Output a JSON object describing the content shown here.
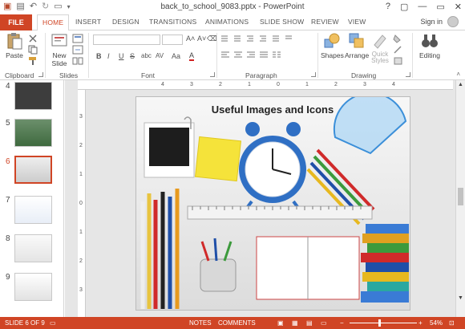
{
  "window": {
    "title": "back_to_school_9083.pptx - PowerPoint",
    "controls": [
      "?",
      "▢",
      "—",
      "▭",
      "✕"
    ]
  },
  "tabs": {
    "file": "FILE",
    "items": [
      "HOME",
      "INSERT",
      "DESIGN",
      "TRANSITIONS",
      "ANIMATIONS",
      "SLIDE SHOW",
      "REVIEW",
      "VIEW"
    ],
    "active": "HOME",
    "signin": "Sign in"
  },
  "ribbon": {
    "clipboard": {
      "label": "Clipboard",
      "paste": "Paste"
    },
    "slides": {
      "label": "Slides",
      "new_slide": "New Slide"
    },
    "font": {
      "label": "Font",
      "buttons": [
        "B",
        "I",
        "U",
        "S",
        "abc",
        "AV",
        "Aa",
        "A"
      ]
    },
    "paragraph": {
      "label": "Paragraph"
    },
    "drawing": {
      "label": "Drawing",
      "shapes": "Shapes",
      "arrange": "Arrange",
      "quick_styles": "Quick Styles"
    },
    "editing": {
      "label": "Editing",
      "editing": "Editing"
    }
  },
  "thumbnails": {
    "numbers": [
      "4",
      "5",
      "6",
      "7",
      "8",
      "9"
    ],
    "selected": "6"
  },
  "ruler": {
    "h_numbers": [
      "4",
      "3",
      "2",
      "1",
      "0",
      "1",
      "2",
      "3",
      "4"
    ],
    "v_numbers": [
      "3",
      "2",
      "1",
      "0",
      "1",
      "2",
      "3"
    ]
  },
  "slide": {
    "title": "Useful Images and Icons"
  },
  "status": {
    "slide": "SLIDE 6 OF 9",
    "notes": "NOTES",
    "comments": "COMMENTS",
    "zoom": "54%"
  },
  "colors": {
    "accent": "#d04525",
    "clock": "#2f6fc4",
    "protractor": "#3b8fd9"
  }
}
